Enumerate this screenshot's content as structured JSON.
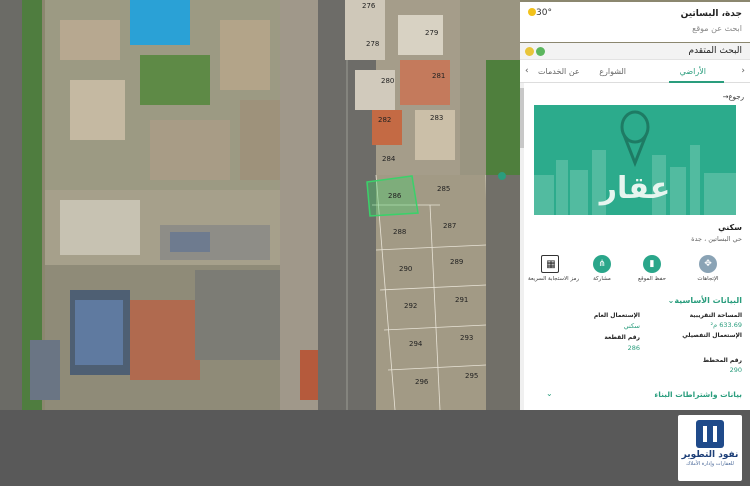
{
  "location_box": {
    "city": "جدة، البساتين",
    "search_placeholder": "ابحث عن موقع",
    "temperature": "30°"
  },
  "panel": {
    "title": "البحث المتقدم",
    "tabs": [
      {
        "label": "الأراضي",
        "active": true
      },
      {
        "label": "الشوارع",
        "active": false
      },
      {
        "label": "البحث عن الخدمات",
        "active": false
      }
    ],
    "back_label": "رجوع",
    "banner_text": "عقار",
    "property_type": "سكني",
    "property_location": "حي البساتين ، جدة",
    "actions": {
      "directions": "الإتجاهات",
      "save": "حفظ الموقع",
      "share": "مشاركة",
      "qr": "رمز الاستجابة السريعة"
    },
    "basic_data_title": "البيانات الأساسية",
    "fields": {
      "area_label": "المساحة التقريبية",
      "area_value": "633.69 م²",
      "general_use_label": "الإستعمال العام",
      "general_use_value": "سكني",
      "detail_use_label": "الإستعمال التفصيلي",
      "parcel_label": "رقم القطعة",
      "parcel_value": "286",
      "plan_label": "رقم المخطط",
      "plan_value": "290"
    },
    "building_title": "بيانات واشتراطات البناء"
  },
  "map": {
    "selected_parcel": "286",
    "parcels": [
      "276",
      "278",
      "279",
      "280",
      "281",
      "282",
      "283",
      "284",
      "285",
      "286",
      "287",
      "288",
      "289",
      "290",
      "291",
      "292",
      "293",
      "294",
      "295",
      "296"
    ]
  },
  "logo": {
    "name": "نفود التطوير",
    "tagline": "للعقارات وإدارة الأملاك"
  },
  "colors": {
    "accent": "#2a9d7d",
    "banner": "#2cab8c",
    "selection": "#3bd16a"
  }
}
